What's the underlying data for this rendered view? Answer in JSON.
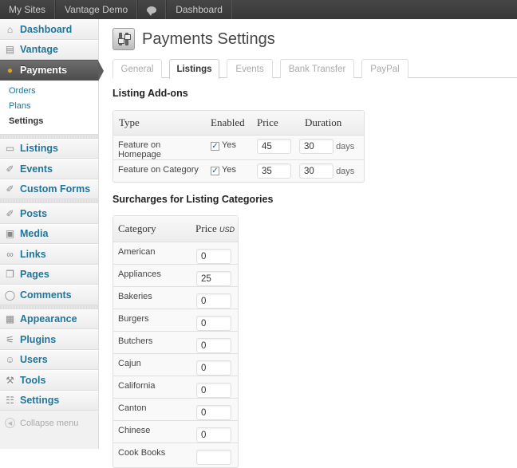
{
  "adminbar": {
    "items": [
      {
        "label": "My Sites"
      },
      {
        "label": "Vantage Demo"
      },
      {
        "label": "",
        "icon": "comment-bubble-icon"
      },
      {
        "label": "Dashboard"
      }
    ]
  },
  "sidebar": {
    "items": [
      {
        "label": "Dashboard",
        "icon": "home-icon"
      },
      {
        "label": "Vantage",
        "icon": "vantage-icon"
      },
      {
        "label": "Payments",
        "icon": "payments-icon",
        "active": true
      }
    ],
    "submenu": [
      "Orders",
      "Plans",
      "Settings"
    ],
    "group2": [
      {
        "label": "Listings",
        "icon": "listings-icon"
      },
      {
        "label": "Events",
        "icon": "pin-icon"
      },
      {
        "label": "Custom Forms",
        "icon": "pin-icon"
      }
    ],
    "group3": [
      {
        "label": "Posts",
        "icon": "pin-icon"
      },
      {
        "label": "Media",
        "icon": "media-icon"
      },
      {
        "label": "Links",
        "icon": "links-icon"
      },
      {
        "label": "Pages",
        "icon": "pages-icon"
      },
      {
        "label": "Comments",
        "icon": "comments-icon"
      }
    ],
    "group4": [
      {
        "label": "Appearance",
        "icon": "appearance-icon"
      },
      {
        "label": "Plugins",
        "icon": "plugins-icon"
      },
      {
        "label": "Users",
        "icon": "users-icon"
      },
      {
        "label": "Tools",
        "icon": "tools-icon"
      },
      {
        "label": "Settings",
        "icon": "settings-icon"
      }
    ],
    "collapse_label": "Collapse menu"
  },
  "main": {
    "title": "Payments Settings",
    "tabs": [
      {
        "label": "General"
      },
      {
        "label": "Listings",
        "active": true
      },
      {
        "label": "Events"
      },
      {
        "label": "Bank Transfer"
      },
      {
        "label": "PayPal"
      }
    ],
    "addons": {
      "heading": "Listing Add-ons",
      "columns": [
        "Type",
        "Enabled",
        "Price",
        "Duration"
      ],
      "rows": [
        {
          "type": "Feature on Homepage",
          "enabled": true,
          "enabled_label": "Yes",
          "price": "45",
          "duration": "30",
          "unit": "days"
        },
        {
          "type": "Feature on Category",
          "enabled": true,
          "enabled_label": "Yes",
          "price": "35",
          "duration": "30",
          "unit": "days"
        }
      ]
    },
    "surcharges": {
      "heading": "Surcharges for Listing Categories",
      "columns": [
        "Category",
        "Price"
      ],
      "currency": "USD",
      "rows": [
        {
          "category": "American",
          "price": "0"
        },
        {
          "category": "Appliances",
          "price": "25"
        },
        {
          "category": "Bakeries",
          "price": "0"
        },
        {
          "category": "Burgers",
          "price": "0"
        },
        {
          "category": "Butchers",
          "price": "0"
        },
        {
          "category": "Cajun",
          "price": "0"
        },
        {
          "category": "California",
          "price": "0"
        },
        {
          "category": "Canton",
          "price": "0"
        },
        {
          "category": "Chinese",
          "price": "0"
        },
        {
          "category": "Cook Books",
          "price": ""
        }
      ]
    }
  }
}
